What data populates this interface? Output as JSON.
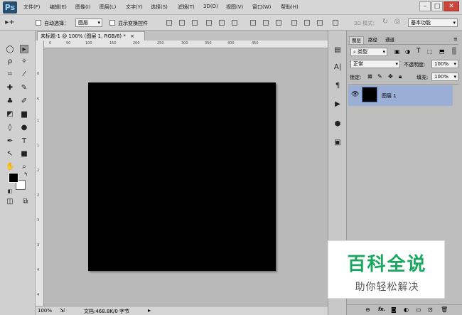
{
  "app": {
    "logo": "Ps"
  },
  "menu": [
    "文件(F)",
    "编辑(E)",
    "图像(I)",
    "图层(L)",
    "文字(Y)",
    "选择(S)",
    "滤镜(T)",
    "3D(D)",
    "视图(V)",
    "窗口(W)",
    "帮助(H)"
  ],
  "options_bar": {
    "auto_select_label": "自动选择：",
    "auto_select_value": "图层",
    "show_transform_label": "显示变换控件",
    "mode_3d_label": "3D 模式：",
    "workspace": "基本功能"
  },
  "document": {
    "tab_title": "未标题-1 @ 100% (图层 1, RGB/8) *",
    "ruler_top_ticks": [
      "0",
      "50",
      "100",
      "150",
      "200",
      "250",
      "300",
      "350",
      "400",
      "450"
    ],
    "ruler_left_ticks": [
      "0",
      "5",
      "1",
      "1",
      "2",
      "2",
      "3",
      "3",
      "4",
      "4"
    ],
    "zoom": "100%",
    "doc_info": "文档:468.8K/0 字节"
  },
  "layers_panel": {
    "tabs": [
      "图层",
      "路径",
      "通道"
    ],
    "filter_label": "类型",
    "blend_mode": "正常",
    "opacity_label": "不透明度:",
    "opacity_value": "100%",
    "lock_label": "锁定:",
    "fill_label": "填充:",
    "fill_value": "100%",
    "layers": [
      {
        "name": "图层 1"
      }
    ],
    "footer_icons": [
      "link-icon",
      "fx-icon",
      "mask-icon",
      "adjustment-icon",
      "folder-icon",
      "new-layer-icon",
      "trash-icon"
    ],
    "footer_fx": "fx."
  },
  "watermark": {
    "title": "百科全说",
    "subtitle": "助你轻松解决"
  },
  "colors": {
    "foreground": "#000000",
    "background": "#ffffff",
    "layer_selected": "#9aaed6",
    "watermark_green": "#1aa860"
  }
}
